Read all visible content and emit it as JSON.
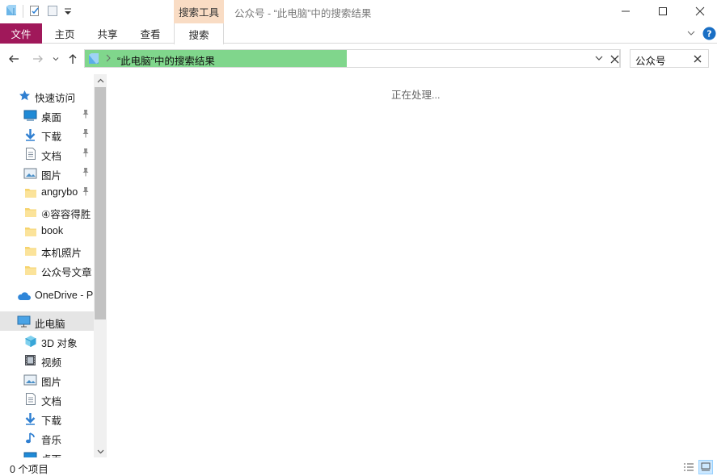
{
  "titlebar": {
    "context_tab": "搜索工具",
    "title": "公众号 - “此电脑”中的搜索结果"
  },
  "ribbon": {
    "tabs": [
      {
        "label": "文件"
      },
      {
        "label": "主页"
      },
      {
        "label": "共享"
      },
      {
        "label": "查看"
      },
      {
        "label": "搜索"
      }
    ]
  },
  "navbar": {
    "address": "“此电脑”中的搜索结果",
    "address_progress": 0.49,
    "search_value": "公众号"
  },
  "navpane": {
    "quick_access": "快速访问",
    "quick_items": [
      {
        "label": "桌面",
        "icon": "desktop-icon"
      },
      {
        "label": "下载",
        "icon": "download-icon"
      },
      {
        "label": "文档",
        "icon": "document-icon"
      },
      {
        "label": "图片",
        "icon": "picture-icon"
      },
      {
        "label": "angrybo",
        "icon": "folder-icon"
      },
      {
        "label": "④容容得胜",
        "icon": "folder-icon"
      },
      {
        "label": "book",
        "icon": "folder-icon"
      },
      {
        "label": "本机照片",
        "icon": "folder-icon"
      },
      {
        "label": "公众号文章",
        "icon": "folder-icon"
      }
    ],
    "onedrive": "OneDrive - P",
    "this_pc": "此电脑",
    "pc_items": [
      {
        "label": "3D 对象",
        "icon": "cube-icon"
      },
      {
        "label": "视频",
        "icon": "video-icon"
      },
      {
        "label": "图片",
        "icon": "picture-icon"
      },
      {
        "label": "文档",
        "icon": "document-icon"
      },
      {
        "label": "下载",
        "icon": "download-icon"
      },
      {
        "label": "音乐",
        "icon": "music-icon"
      },
      {
        "label": "桌面",
        "icon": "desktop-icon"
      }
    ]
  },
  "content": {
    "processing": "正在处理..."
  },
  "statusbar": {
    "items": "0 个项目"
  },
  "colors": {
    "file_tab": "#a0185a",
    "context_tab": "#f9dcc4",
    "progress": "#80d68c",
    "selection": "#e5e5e5",
    "help": "#1a6fc4"
  }
}
